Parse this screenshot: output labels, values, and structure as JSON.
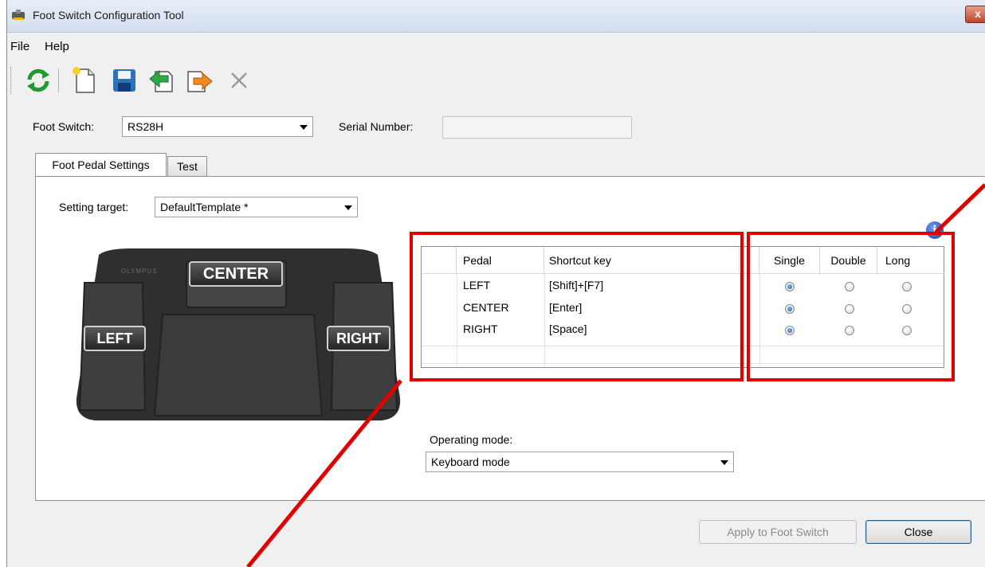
{
  "window": {
    "title": "Foot Switch Configuration Tool",
    "close_glyph": "x"
  },
  "menu": {
    "items": [
      "File",
      "Help"
    ]
  },
  "toolbar": {
    "icons": [
      "refresh-icon",
      "new-file-icon",
      "save-icon",
      "import-icon",
      "export-icon",
      "delete-icon"
    ]
  },
  "foot_switch": {
    "label": "Foot Switch:",
    "value": "RS28H"
  },
  "serial": {
    "label": "Serial Number:",
    "value": ""
  },
  "tabs": [
    {
      "label": "Foot Pedal Settings",
      "active": true
    },
    {
      "label": "Test",
      "active": false
    }
  ],
  "setting_target": {
    "label": "Setting target:",
    "value": "DefaultTemplate *"
  },
  "pedal_labels": {
    "center": "CENTER",
    "left": "LEFT",
    "right": "RIGHT",
    "brand": "OLYMPUS"
  },
  "grid": {
    "headers": {
      "pedal": "Pedal",
      "shortcut": "Shortcut key",
      "single": "Single",
      "double": "Double",
      "long": "Long"
    },
    "rows": [
      {
        "pedal": "LEFT",
        "shortcut": "[Shift]+[F7]",
        "mode": "single"
      },
      {
        "pedal": "CENTER",
        "shortcut": "[Enter]",
        "mode": "single"
      },
      {
        "pedal": "RIGHT",
        "shortcut": "[Space]",
        "mode": "single"
      }
    ]
  },
  "info_glyph": "i",
  "operating_mode": {
    "label": "Operating mode:",
    "value": "Keyboard mode"
  },
  "buttons": {
    "apply": "Apply to Foot Switch",
    "close": "Close"
  },
  "colors": {
    "highlight": "#e00000",
    "accent": "#1d5fa8"
  }
}
